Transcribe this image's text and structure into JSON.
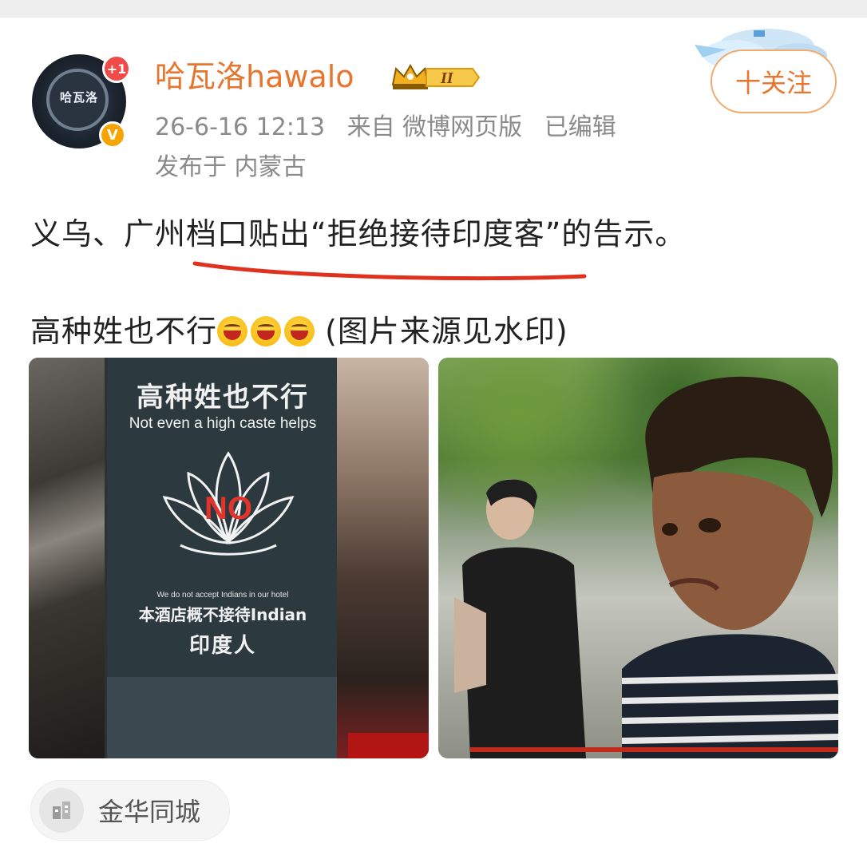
{
  "post": {
    "user": {
      "name": "哈瓦洛hawalo",
      "avatar_text": "哈瓦洛",
      "avatar_badge": "+1",
      "verified_badge": "V",
      "vip_level": "II"
    },
    "meta": {
      "date": "26-6-16 12:13",
      "source": "来自 微博网页版",
      "edited": "已编辑",
      "location": "发布于 内蒙古"
    },
    "follow_label": "十关注",
    "text": {
      "line1": "义乌、广州档口贴出“拒绝接待印度客”的告示。",
      "line2_prefix": "高种姓也不行",
      "line2_suffix": " (图片来源见水印)"
    },
    "images": {
      "left": {
        "sign_title": "高种姓也不行",
        "sign_subtitle": "Not even a high caste helps",
        "sign_no": "NO",
        "sign_small": "We do not accept Indians in our hotel",
        "sign_cn_line": "本酒店概不接待Indian",
        "sign_cn_line2": "印度人"
      }
    },
    "location_tag": "金华同城"
  },
  "colors": {
    "username": "#e8752e",
    "meta": "#8a8a8a",
    "follow_border": "#f3a96a",
    "underline": "#e0301e"
  },
  "icons": [
    "verified-v-icon",
    "vip-crown-icon",
    "location-city-icon",
    "laugh-emoji-icon"
  ]
}
